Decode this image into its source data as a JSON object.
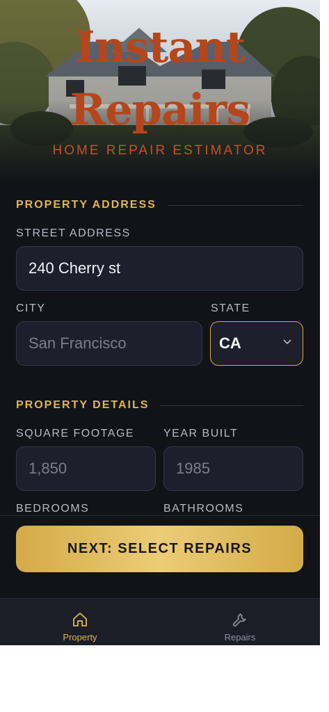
{
  "header": {
    "title_line1": "Instant",
    "title_line2": "Repairs",
    "subtitle": "HOME REPAIR ESTIMATOR"
  },
  "address_section": {
    "heading": "PROPERTY ADDRESS",
    "street_label": "STREET ADDRESS",
    "street_value": "240 Cherry st",
    "city_label": "CITY",
    "city_placeholder": "San Francisco",
    "state_label": "STATE",
    "state_value": "CA"
  },
  "details_section": {
    "heading": "PROPERTY DETAILS",
    "sqft_label": "SQUARE FOOTAGE",
    "sqft_placeholder": "1,850",
    "year_label": "YEAR BUILT",
    "year_placeholder": "1985",
    "bedrooms_label": "BEDROOMS",
    "bathrooms_label": "BATHROOMS"
  },
  "cta": {
    "label": "NEXT: SELECT REPAIRS"
  },
  "tabs": [
    {
      "label": "Property",
      "icon": "home-icon",
      "active": true
    },
    {
      "label": "Repairs",
      "icon": "wrench-icon",
      "active": false
    }
  ],
  "colors": {
    "background": "#111318",
    "accent_gold": "#e1b64f",
    "title_rust": "#b5461c",
    "field_bg": "#1d1f2d"
  }
}
